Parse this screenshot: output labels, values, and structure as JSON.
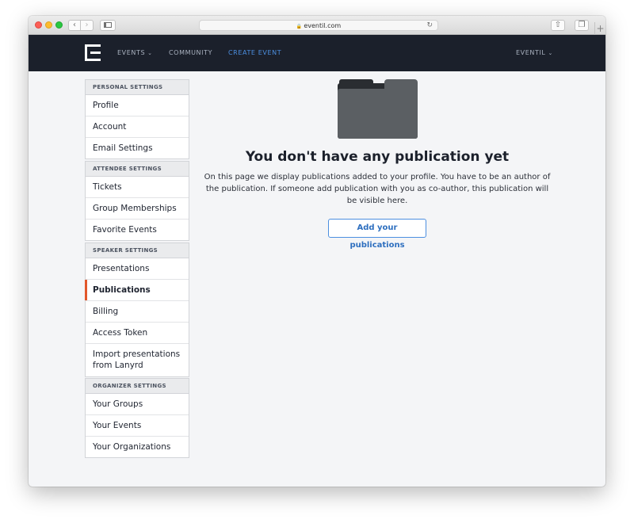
{
  "browser": {
    "url": "eventil.com"
  },
  "header": {
    "nav": [
      {
        "label": "EVENTS",
        "has_dropdown": true
      },
      {
        "label": "COMMUNITY",
        "has_dropdown": false
      },
      {
        "label": "CREATE EVENT",
        "has_dropdown": false
      }
    ],
    "user_menu": {
      "label": "EVENTIL",
      "has_dropdown": true
    },
    "accent_color": "#4c8fe0"
  },
  "sidebar": {
    "groups": [
      {
        "title": "PERSONAL SETTINGS",
        "items": [
          {
            "label": "Profile"
          },
          {
            "label": "Account"
          },
          {
            "label": "Email Settings"
          }
        ]
      },
      {
        "title": "ATTENDEE SETTINGS",
        "items": [
          {
            "label": "Tickets"
          },
          {
            "label": "Group Memberships"
          },
          {
            "label": "Favorite Events"
          }
        ]
      },
      {
        "title": "SPEAKER SETTINGS",
        "items": [
          {
            "label": "Presentations"
          },
          {
            "label": "Publications",
            "active": true
          },
          {
            "label": "Billing"
          },
          {
            "label": "Access Token"
          },
          {
            "label": "Import presentations from Lanyrd"
          }
        ]
      },
      {
        "title": "ORGANIZER SETTINGS",
        "items": [
          {
            "label": "Your Groups"
          },
          {
            "label": "Your Events"
          },
          {
            "label": "Your Organizations"
          }
        ]
      }
    ],
    "active_indicator_color": "#e2572b"
  },
  "main": {
    "empty_state": {
      "icon": "folder-icon",
      "title": "You don't have any publication yet",
      "description": "On this page we display publications added to your profile. You have to be an author of the publication. If someone add publication with you as co-author, this publication will be visible here.",
      "button_label": "Add your publications"
    }
  }
}
